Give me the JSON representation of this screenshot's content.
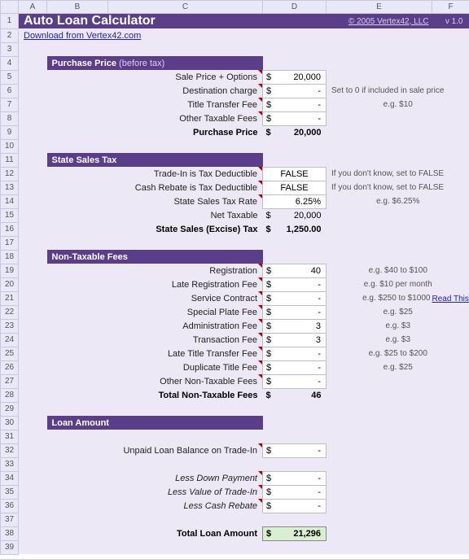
{
  "cols": [
    "A",
    "B",
    "C",
    "D",
    "E",
    "F"
  ],
  "rows": [
    "1",
    "2",
    "3",
    "4",
    "5",
    "6",
    "7",
    "8",
    "9",
    "10",
    "11",
    "12",
    "13",
    "14",
    "15",
    "16",
    "17",
    "18",
    "19",
    "20",
    "21",
    "22",
    "23",
    "24",
    "25",
    "26",
    "27",
    "28",
    "29",
    "30",
    "31",
    "32",
    "33",
    "34",
    "35",
    "36",
    "37",
    "38",
    "39"
  ],
  "title": "Auto Loan Calculator",
  "copyright": "© 2005 Vertex42, LLC",
  "version": "v 1.0",
  "download": "Download from Vertex42.com",
  "sections": {
    "purchase_label": "Purchase Price",
    "purchase_tail": " (before tax)",
    "tax_label": "State Sales Tax",
    "fees_label": "Non-Taxable Fees",
    "loan_label": "Loan Amount"
  },
  "purchase": {
    "r5": {
      "label": "Sale Price + Options",
      "cur": "$",
      "val": "20,000"
    },
    "r6": {
      "label": "Destination charge",
      "cur": "$",
      "val": "-",
      "note": "Set to 0 if included in sale price"
    },
    "r7": {
      "label": "Title Transfer Fee",
      "cur": "$",
      "val": "-",
      "note": "e.g. $10"
    },
    "r8": {
      "label": "Other Taxable Fees",
      "cur": "$",
      "val": "-"
    },
    "total": {
      "label": "Purchase Price",
      "cur": "$",
      "val": "20,000"
    }
  },
  "tax": {
    "r12": {
      "label": "Trade-In is Tax Deductible",
      "val": "FALSE",
      "note": "If you don't know, set to FALSE"
    },
    "r13": {
      "label": "Cash Rebate is Tax Deductible",
      "val": "FALSE",
      "note": "If you don't know, set to FALSE"
    },
    "r14": {
      "label": "State Sales Tax Rate",
      "val": "6.25%",
      "note": "e.g. $6.25%"
    },
    "r15": {
      "label": "Net Taxable",
      "cur": "$",
      "val": "20,000"
    },
    "total": {
      "label": "State Sales (Excise) Tax",
      "cur": "$",
      "val": "1,250.00"
    }
  },
  "fees": {
    "r19": {
      "label": "Registration",
      "cur": "$",
      "val": "40",
      "note": "e.g. $40 to $100"
    },
    "r20": {
      "label": "Late Registration Fee",
      "cur": "$",
      "val": "-",
      "note": "e.g. $10 per month"
    },
    "r21": {
      "label": "Service Contract",
      "cur": "$",
      "val": "-",
      "note": "e.g. $250 to $1000",
      "link": "Read This"
    },
    "r22": {
      "label": "Special Plate Fee",
      "cur": "$",
      "val": "-",
      "note": "e.g. $25"
    },
    "r23": {
      "label": "Administration Fee",
      "cur": "$",
      "val": "3",
      "note": "e.g. $3"
    },
    "r24": {
      "label": "Transaction Fee",
      "cur": "$",
      "val": "3",
      "note": "e.g. $3"
    },
    "r25": {
      "label": "Late Title Transfer Fee",
      "cur": "$",
      "val": "-",
      "note": "e.g. $25 to $200"
    },
    "r26": {
      "label": "Duplicate Title Fee",
      "cur": "$",
      "val": "-",
      "note": "e.g. $25"
    },
    "r27": {
      "label": "Other Non-Taxable Fees",
      "cur": "$",
      "val": "-"
    },
    "total": {
      "label": "Total Non-Taxable Fees",
      "cur": "$",
      "val": "46"
    }
  },
  "loan": {
    "r32": {
      "label": "Unpaid Loan Balance on Trade-In",
      "cur": "$",
      "val": "-"
    },
    "r34": {
      "label": "Less Down Payment",
      "cur": "$",
      "val": "-"
    },
    "r35": {
      "label": "Less Value of Trade-In",
      "cur": "$",
      "val": "-"
    },
    "r36": {
      "label": "Less Cash Rebate",
      "cur": "$",
      "val": "-"
    },
    "total": {
      "label": "Total Loan Amount",
      "cur": "$",
      "val": "21,296"
    }
  }
}
